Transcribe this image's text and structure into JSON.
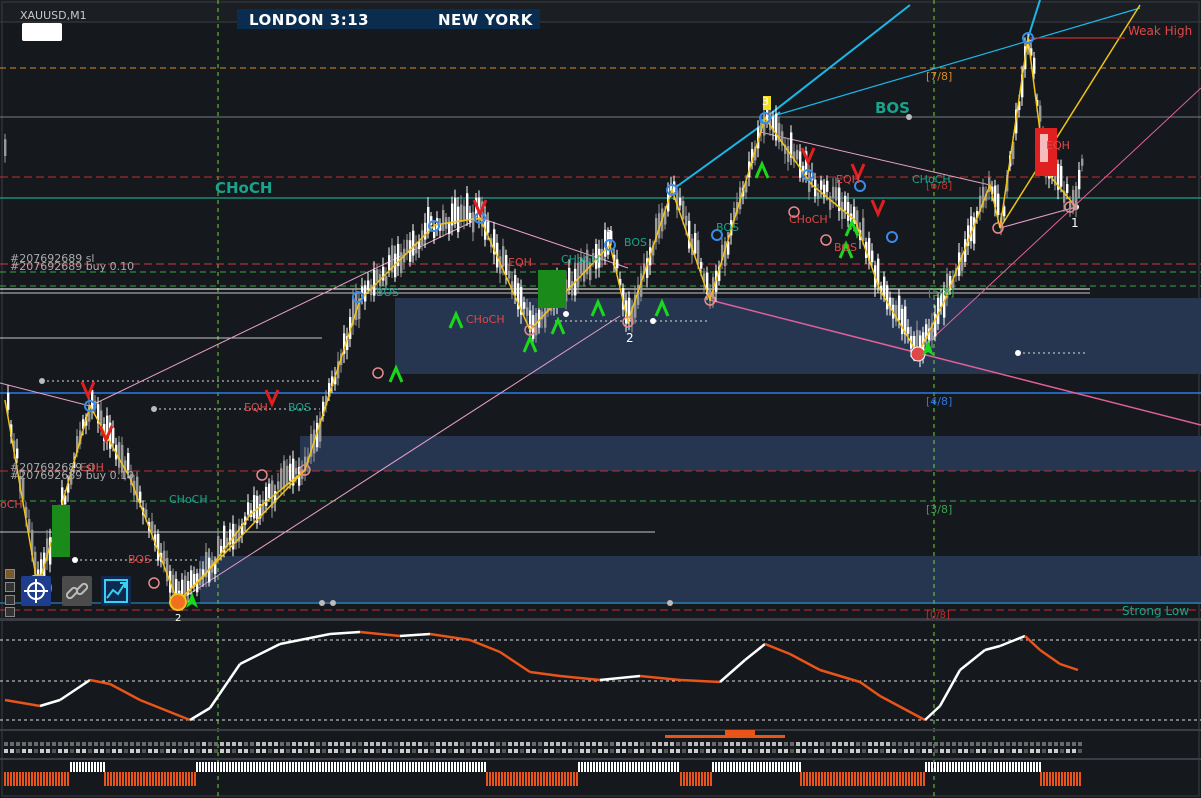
{
  "window": {
    "symbol_title": "XAUUSD,M1"
  },
  "sessions": {
    "london": "LONDON 3:13",
    "new_york": "NEW YORK"
  },
  "labels": {
    "bos_big": "BOS",
    "choch_big": "CHoCH",
    "weak_high": "Weak High",
    "strong_low": "Strong Low",
    "fib_7_8": "[7/8]",
    "fib_4_8": "[4/8]",
    "fib_3_8": "[3/8]",
    "fib_6_8": "[6/8]",
    "fib_5_8": "[5/8]",
    "fib_0_8": "[0/8]",
    "order_sl_1": "#207692689 sl",
    "order_buy_1": "#207692689 buy 0.10",
    "order_sl_2": "#207692689 sl",
    "order_buy_2": "#207692689 buy 0.10",
    "choch_left": "oCH",
    "choch_lowleft": "CHoCH",
    "choch_mid": "CHoCH",
    "choch_mid2": "CHoCH",
    "choch_right": "CHoCH",
    "choch_right2": "CHoCH",
    "bos_1": "BOS",
    "bos_2": "BOS",
    "bos_3": "BOS",
    "bos_4": "BOS",
    "bos_5": "BOS",
    "bos_low": "BOS",
    "eqh_1": "EQH",
    "eqh_2": "EQH",
    "eqh_3": "EQH",
    "eqh_4": "EQH",
    "eqh_5": "EQH",
    "num_1a": "1",
    "num_1b": "1",
    "num_2a": "2",
    "num_2b": "2",
    "num_3": "3"
  },
  "colors": {
    "background": "#15181c",
    "bos": "#1aa38a",
    "choch": "#1aa38a",
    "weak_high": "#e04848",
    "strong_low": "#1aa38a",
    "zigzag": "#f0c419",
    "trend_blue": "#19b8e8",
    "trend_pink": "#e0609a",
    "fib_orange": "#d88a2a",
    "fib_blue": "#2a7ae8",
    "fib_green": "#2aa34a",
    "zone": "#263650",
    "oscillator_up": "#ffffff",
    "oscillator_down": "#e8541a"
  },
  "toolbar": {
    "crosshair_icon": "crosshair-icon",
    "link_icon": "chain-link-icon",
    "chart_icon": "trend-chart-icon"
  }
}
